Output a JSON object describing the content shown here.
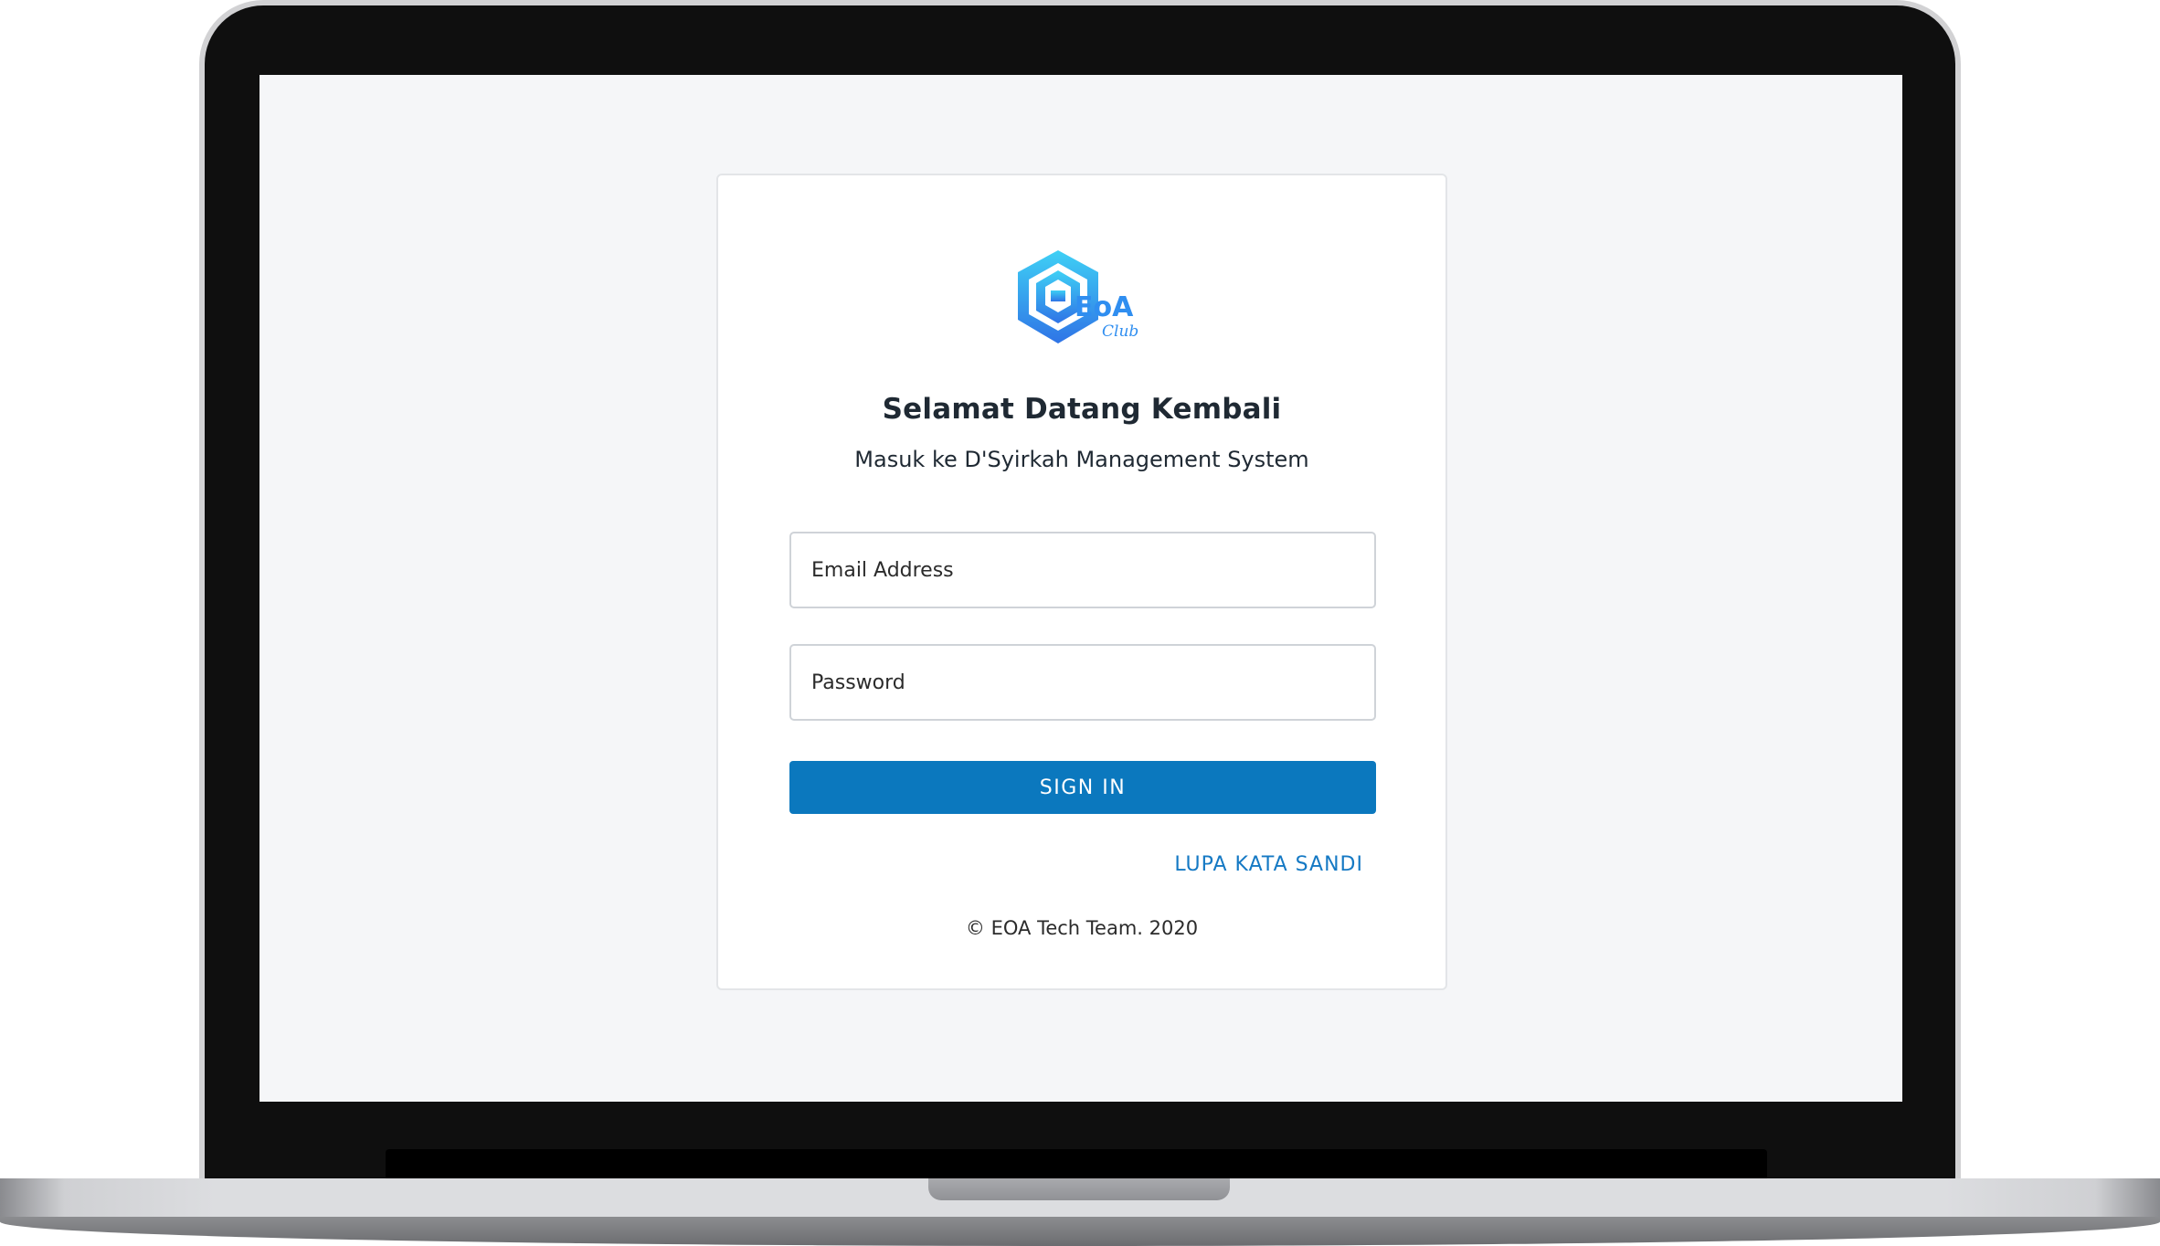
{
  "login": {
    "title": "Selamat Datang Kembali",
    "subtitle": "Masuk ke D'Syirkah Management System",
    "email_placeholder": "Email Address",
    "password_placeholder": "Password",
    "signin_label": "SIGN IN",
    "forgot_label": "LUPA KATA SANDI",
    "footer": "© EOA Tech Team. 2020"
  },
  "logo": {
    "text": "EoA",
    "subtext": "Club"
  },
  "colors": {
    "primary": "#0b78be",
    "link": "#1579c4",
    "background": "#f5f6f8",
    "logo_blue": "#2f8ef0",
    "logo_cyan": "#3fd0f5"
  }
}
